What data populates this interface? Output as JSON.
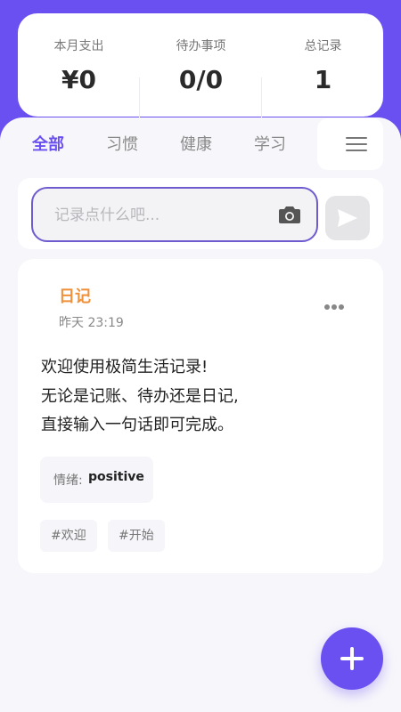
{
  "stats": [
    {
      "label": "本月支出",
      "value": "¥0"
    },
    {
      "label": "待办事项",
      "value": "0/0"
    },
    {
      "label": "总记录",
      "value": "1"
    }
  ],
  "tabs": [
    {
      "label": "全部",
      "active": true
    },
    {
      "label": "习惯",
      "active": false
    },
    {
      "label": "健康",
      "active": false
    },
    {
      "label": "学习",
      "active": false
    }
  ],
  "input": {
    "placeholder": "记录点什么吧...",
    "value": ""
  },
  "entries": [
    {
      "type": "日记",
      "time": "昨天 23:19",
      "lines": [
        "欢迎使用极简生活记录!",
        "无论是记账、待办还是日记,",
        "直接输入一句话即可完成。"
      ],
      "mood_label": "情绪:",
      "mood_value": "positive",
      "tags": [
        "#欢迎",
        "#开始"
      ]
    }
  ],
  "colors": {
    "accent": "#6a50f0",
    "diary": "#f0913a"
  },
  "icons": {
    "menu": "menu-icon",
    "camera": "camera-icon",
    "send": "send-icon",
    "more": "more-icon",
    "add": "plus-icon"
  }
}
